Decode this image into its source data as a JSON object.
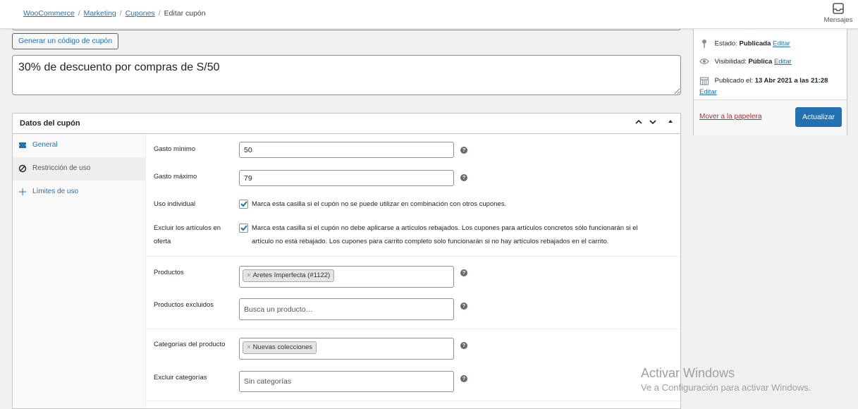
{
  "breadcrumb": {
    "items": [
      "WooCommerce",
      "Marketing",
      "Cupones"
    ],
    "current": "Editar cupón"
  },
  "topbar": {
    "inbox_label": "Mensajes"
  },
  "coupon": {
    "generate_button": "Generar un código de cupón",
    "description": "30% de descuento por compras de S/50"
  },
  "panel": {
    "title": "Datos del cupón",
    "tabs": [
      {
        "label": "General",
        "icon": "ticket-icon"
      },
      {
        "label": "Restricción de uso",
        "icon": "block-icon"
      },
      {
        "label": "Límites de uso",
        "icon": "plus-icon"
      }
    ]
  },
  "restriction": {
    "min_spend_label": "Gasto mínimo",
    "min_spend_value": "50",
    "max_spend_label": "Gasto máximo",
    "max_spend_value": "79",
    "individual_use_label": "Uso individual",
    "individual_use_text": "Marca esta casilla si el cupón no se puede utilizar en combinación con otros cupones.",
    "individual_use_checked": true,
    "exclude_sale_label_1": "Excluir los artículos en",
    "exclude_sale_label_2": "oferta",
    "exclude_sale_text_1": "Marca esta casilla si el cupón no debe aplicarse a artículos rebajados. Los cupones para artículos concretos sólo funcionarán si el",
    "exclude_sale_text_2": "artículo no está rebajado. Los cupones para carrito completo solo funcionarán si no hay artículos rebajados en el carrito.",
    "exclude_sale_checked": true,
    "products_label": "Productos",
    "products_tag": "Aretes Imperfecta (#1122)",
    "excluded_products_label": "Productos excluidos",
    "excluded_products_placeholder": "Busca un producto…",
    "categories_label": "Categorías del producto",
    "categories_tag": "Nuevas colecciones",
    "exclude_categories_label": "Excluir categorías",
    "exclude_categories_placeholder": "Sin categorías"
  },
  "publish": {
    "status_label": "Estado:",
    "status_value": "Publicada",
    "visibility_label": "Visibilidad:",
    "visibility_value": "Pública",
    "published_label": "Publicado el:",
    "published_value": "13 Abr 2021 a las 21:28",
    "edit_link": "Editar",
    "trash_link": "Mover a la papelera",
    "update_button": "Actualizar"
  },
  "watermark": {
    "line1": "Activar Windows",
    "line2": "Ve a Configuración para activar Windows."
  },
  "colors": {
    "accent": "#2271b1",
    "danger": "#b32d2e"
  }
}
